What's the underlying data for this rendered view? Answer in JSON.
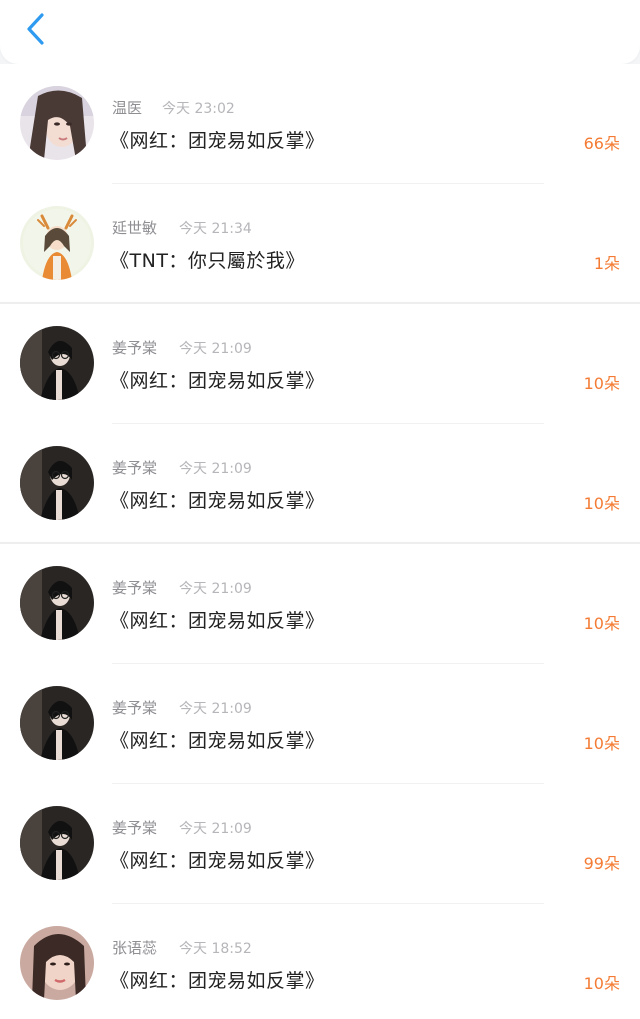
{
  "header": {
    "back_icon": "chevron-left-icon",
    "accent_color": "#2f9bf0"
  },
  "list": {
    "items": [
      {
        "name": "温医",
        "time": "今天 23:02",
        "title": "《网红：团宠易如反掌》",
        "amount": "66朵",
        "avatar": "portrait-girl-light"
      },
      {
        "name": "延世敏",
        "time": "今天 21:34",
        "title": "《TNT：你只屬於我》",
        "amount": "1朵",
        "avatar": "illustrated-girl-deer-ears"
      },
      {
        "name": "姜予棠",
        "time": "今天 21:09",
        "title": "《网红：团宠易如反掌》",
        "amount": "10朵",
        "avatar": "portrait-dark-glasses"
      },
      {
        "name": "姜予棠",
        "time": "今天 21:09",
        "title": "《网红：团宠易如反掌》",
        "amount": "10朵",
        "avatar": "portrait-dark-glasses"
      },
      {
        "name": "姜予棠",
        "time": "今天 21:09",
        "title": "《网红：团宠易如反掌》",
        "amount": "10朵",
        "avatar": "portrait-dark-glasses"
      },
      {
        "name": "姜予棠",
        "time": "今天 21:09",
        "title": "《网红：团宠易如反掌》",
        "amount": "10朵",
        "avatar": "portrait-dark-glasses"
      },
      {
        "name": "姜予棠",
        "time": "今天 21:09",
        "title": "《网红：团宠易如反掌》",
        "amount": "99朵",
        "avatar": "portrait-dark-glasses"
      },
      {
        "name": "张语蕊",
        "time": "今天 18:52",
        "title": "《网红：团宠易如反掌》",
        "amount": "10朵",
        "avatar": "portrait-girl-warm"
      }
    ]
  },
  "colors": {
    "amount": "#f47b34",
    "name": "#8e8e93",
    "time": "#b6b6ba",
    "title": "#222222"
  }
}
